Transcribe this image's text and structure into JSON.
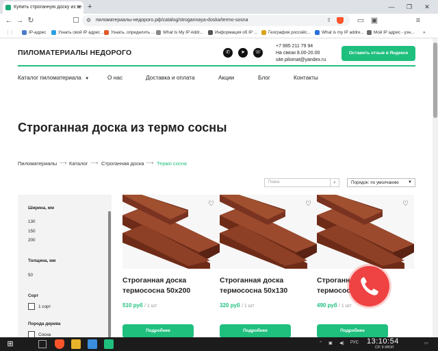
{
  "browser": {
    "tab_title": "Купить строганную доску из те",
    "new_tab": "+",
    "url": "пиломатериалы-недорого.рф/catalog/strogannaya-doska/termo-sosna",
    "bookmarks": [
      {
        "label": "IP-адрес",
        "color": "#4a7cc7"
      },
      {
        "label": "Узнать свой IP адрес ...",
        "color": "#2aa0e0"
      },
      {
        "label": "Узнать, определить ...",
        "color": "#e05a2a"
      },
      {
        "label": "What Is My IP Addr...",
        "color": "#888888"
      },
      {
        "label": "Информация об IP ...",
        "color": "#555555"
      },
      {
        "label": "География российс...",
        "color": "#d8a21a"
      },
      {
        "label": "What is my IP addre...",
        "color": "#2a6fd8"
      },
      {
        "label": "Мой IP адрес - узн...",
        "color": "#6a6a6a"
      }
    ],
    "more_bookmarks": "»"
  },
  "header": {
    "logo": "ПИЛОМАТЕРИАЛЫ НЕДОРОГО",
    "social_icons": [
      "whatsapp-icon",
      "telegram-icon",
      "viber-icon"
    ],
    "phone": "+7 985 211 79 94",
    "hours": "На связи 8.00-20.00",
    "email": "site.pilomat@yandex.ru",
    "review_button": "Оставить отзыв в Яндексе"
  },
  "menu": {
    "items": [
      "Каталог пиломатериала",
      "О нас",
      "Доставка и оплата",
      "Акции",
      "Блог",
      "Контакты"
    ]
  },
  "page_title": "Строганная доска из термо сосны",
  "breadcrumb": {
    "items": [
      "Пиломатериалы",
      "Каталог",
      "Строганная доска",
      "Термо сосна"
    ],
    "separator": "⟶"
  },
  "search": {
    "placeholder": "Поиск"
  },
  "sort": {
    "selected": "Порядок: по умолчанию"
  },
  "filter": {
    "width_title": "Ширина, мм",
    "width_values": [
      "130",
      "150",
      "200"
    ],
    "thickness_title": "Толщина, мм",
    "thickness_values": [
      "50"
    ],
    "grade_title": "Сорт",
    "grade_options": [
      "1 сорт"
    ],
    "wood_title": "Порода дерева",
    "wood_options": [
      "Сосна"
    ]
  },
  "products": [
    {
      "title": "Строганная доска термососна 50x200",
      "price": "510 руб",
      "unit": "/ 1 шт",
      "button": "Подробнее"
    },
    {
      "title": "Строганная доска термососна 50x130",
      "price": "320 руб",
      "unit": "/ 1 шт",
      "button": "Подробнее"
    },
    {
      "title": "Строганная доска термососна 50x150",
      "price": "490 руб",
      "unit": "/ 1 шт",
      "button": "Подробнее"
    }
  ],
  "colors": {
    "accent": "#1fbf7e",
    "call": "#ef4242",
    "wood": "#8b3a22"
  },
  "taskbar": {
    "time": "13:10:54",
    "date": "СР, 9 ИЮЛ",
    "lang": "РУС"
  }
}
